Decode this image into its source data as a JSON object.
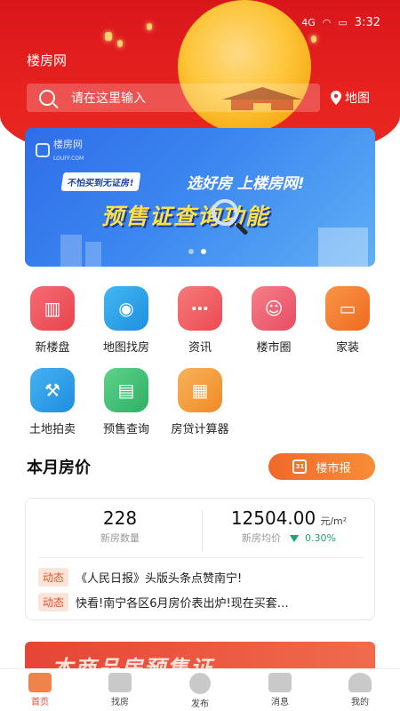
{
  "status_bar": {
    "time": "3:32",
    "signal": "4G",
    "wifi": "wifi",
    "battery": "battery"
  },
  "header": {
    "app_title": "楼房网",
    "search_placeholder": "请在这里输入",
    "map_label": "地图"
  },
  "banner": {
    "logo_text": "楼房网",
    "logo_sub": "LOUFF.COM",
    "tag": "不怕买到无证房!",
    "slogan": "选好房 上楼房网!",
    "headline": "预售证查询功能",
    "slide_count": 2,
    "active_slide": 2
  },
  "menu": [
    {
      "label": "新楼盘",
      "icon": "building-icon",
      "color": "#f0505a"
    },
    {
      "label": "地图找房",
      "icon": "map-pin-icon",
      "color": "#2aa3ea"
    },
    {
      "label": "资讯",
      "icon": "chat-bubble-icon",
      "color": "#ef5a5e"
    },
    {
      "label": "楼市圈",
      "icon": "smile-bubble-icon",
      "color": "#ee5a6a"
    },
    {
      "label": "家装",
      "icon": "sofa-icon",
      "color": "#f47a2e"
    },
    {
      "label": "土地拍卖",
      "icon": "gavel-icon",
      "color": "#2b9ee6"
    },
    {
      "label": "预售查询",
      "icon": "id-card-icon",
      "color": "#3fbf74"
    },
    {
      "label": "房贷计算器",
      "icon": "calculator-icon",
      "color": "#f49a36"
    }
  ],
  "price": {
    "title": "本月房价",
    "report_button": "楼市报",
    "report_icon_text": "31",
    "new_count": "228",
    "new_count_label": "新房数量",
    "avg_price": "12504.00",
    "avg_unit": "元/m²",
    "avg_label": "新房均价",
    "change": "0.30%"
  },
  "news": [
    {
      "tag": "动态",
      "text": "《人民日报》头版头条点赞南宁!"
    },
    {
      "tag": "动态",
      "text": "快看!南宁各区6月房价表出炉!现在买套…"
    }
  ],
  "promo": {
    "text": "本商品房预售证"
  },
  "tabs": [
    {
      "label": "首页",
      "active": true
    },
    {
      "label": "找房",
      "active": false
    },
    {
      "label": "发布",
      "active": false
    },
    {
      "label": "消息",
      "active": false
    },
    {
      "label": "我的",
      "active": false
    }
  ],
  "colors": {
    "brand_red": "#e52a22",
    "accent_orange": "#f2682b",
    "up_down_green": "#1aa56a"
  }
}
